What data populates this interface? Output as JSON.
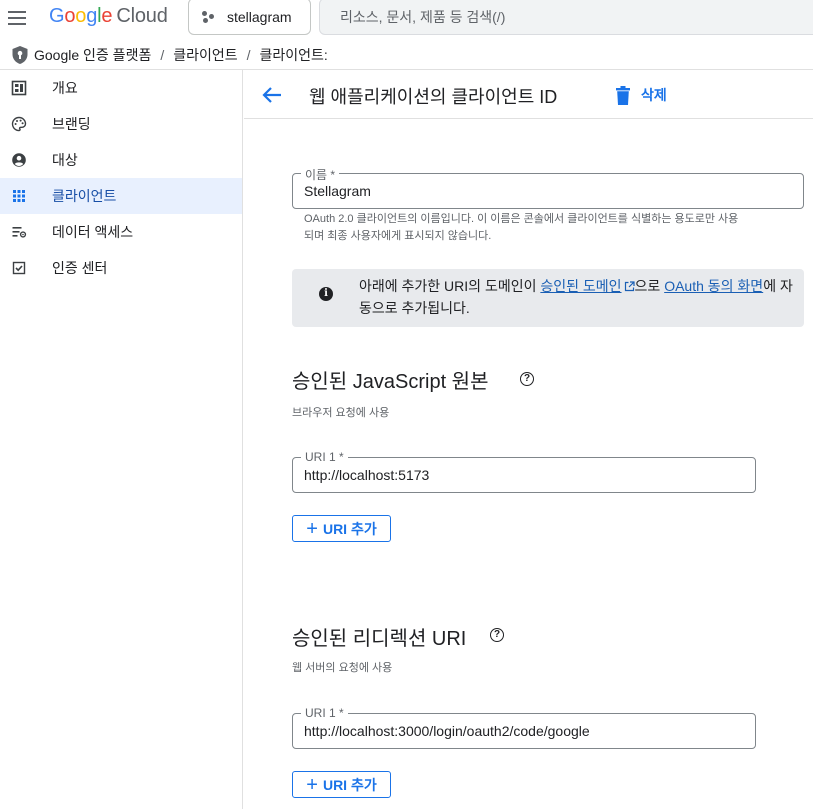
{
  "header": {
    "logo": {
      "google": "Google",
      "cloud": "Cloud"
    },
    "project": "stellagram",
    "search_placeholder": "리소스, 문서, 제품 등 검색(/)"
  },
  "breadcrumb": {
    "items": [
      "Google 인증 플랫폼",
      "클라이언트",
      "클라이언트:"
    ],
    "separator": "/"
  },
  "sidebar": {
    "items": [
      {
        "label": "개요",
        "icon": "dashboard-icon",
        "active": false
      },
      {
        "label": "브랜딩",
        "icon": "palette-icon",
        "active": false
      },
      {
        "label": "대상",
        "icon": "account-circle-icon",
        "active": false
      },
      {
        "label": "클라이언트",
        "icon": "apps-grid-icon",
        "active": true
      },
      {
        "label": "데이터 액세스",
        "icon": "data-access-icon",
        "active": false
      },
      {
        "label": "인증 센터",
        "icon": "checkbox-icon",
        "active": false
      }
    ]
  },
  "main": {
    "title": "웹 애플리케이션의 클라이언트 ID",
    "delete_label": "삭제",
    "name_field": {
      "label": "이름 *",
      "value": "Stellagram",
      "helper_line1": "OAuth 2.0 클라이언트의 이름입니다. 이 이름은 콘솔에서 클라이언트를 식별하는 용도로만 사용",
      "helper_line2": "되며 최종 사용자에게 표시되지 않습니다."
    },
    "info": {
      "part1": "아래에 추가한 URI의 도메인이 ",
      "link1": "승인된 도메인",
      "part2": "으로 ",
      "link2": "OAuth 동의 화면",
      "part3": "에 자동으로 추가됩니다."
    },
    "js_origins": {
      "title": "승인된 JavaScript 원본",
      "subtitle": "브라우저 요청에 사용",
      "uri_label": "URI 1 *",
      "uri_value": "http://localhost:5173",
      "add_label": "URI 추가"
    },
    "redirect_uris": {
      "title": "승인된 리디렉션 URI",
      "subtitle": "웹 서버의 요청에 사용",
      "uri_label": "URI 1 *",
      "uri_value": "http://localhost:3000/login/oauth2/code/google",
      "add_label": "URI 추가"
    }
  },
  "colors": {
    "accent": "#1a73e8",
    "active_nav_bg": "#e8f0fe",
    "info_bg": "#e8eaed"
  }
}
